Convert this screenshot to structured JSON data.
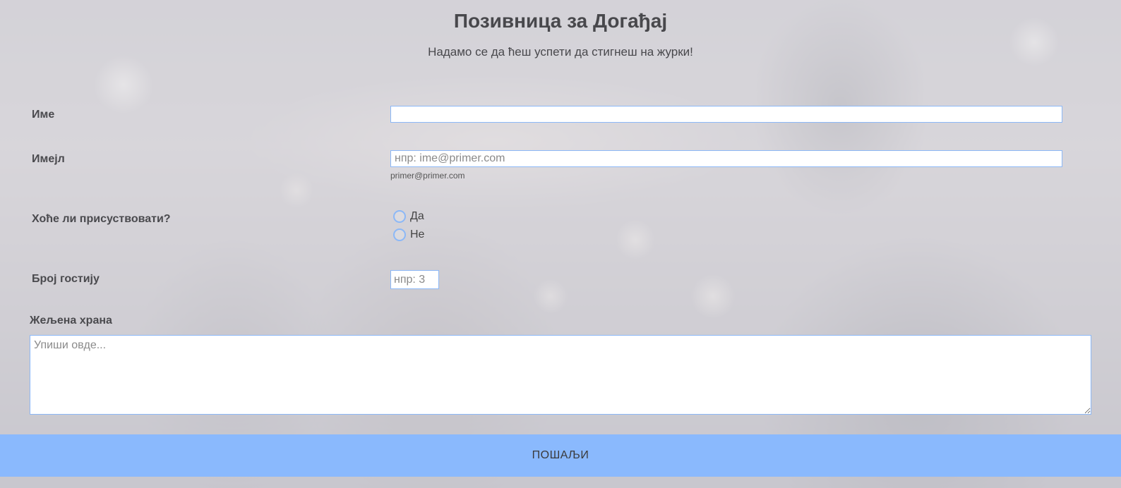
{
  "header": {
    "title": "Позивница за Догађај",
    "subtitle": "Надамо се да ћеш успети да стигнеш на журки!"
  },
  "form": {
    "name": {
      "label": "Име",
      "value": "",
      "placeholder": ""
    },
    "email": {
      "label": "Имејл",
      "value": "",
      "placeholder": "нпр: ime@primer.com",
      "hint": "primer@primer.com"
    },
    "attendance": {
      "label": "Хоће ли присуствовати?",
      "options": [
        {
          "label": "Да",
          "selected": false
        },
        {
          "label": "Не",
          "selected": false
        }
      ]
    },
    "guests": {
      "label": "Број гостију",
      "value": "",
      "placeholder": "нпр: 3"
    },
    "food": {
      "label": "Жељена храна",
      "value": "",
      "placeholder": "Упиши овде..."
    },
    "submit_label": "ПОШАЉИ"
  },
  "colors": {
    "accent": "#8ab9fd",
    "input_border": "#8cb8f7",
    "text": "#4a4a4e"
  },
  "icons": {
    "radio": "radio-circle-icon",
    "resize": "resize-handle-icon"
  }
}
